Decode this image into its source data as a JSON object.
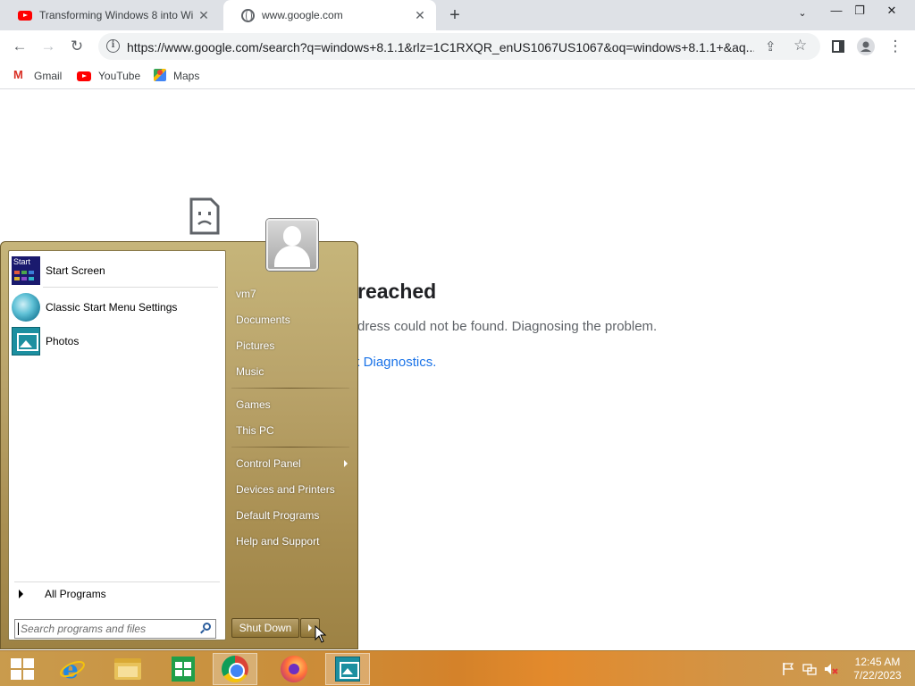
{
  "browser": {
    "tabs": [
      {
        "title": "Transforming Windows 8 into Wi",
        "favicon": "youtube-icon"
      },
      {
        "title": "www.google.com",
        "favicon": "globe-icon"
      }
    ],
    "new_tab_symbol": "+",
    "url": "https://www.google.com/search?q=windows+8.1.1&rlz=1C1RXQR_enUS1067US1067&oq=windows+8.1.1+&aq...",
    "bookmarks": [
      {
        "label": "Gmail",
        "icon": "gmail-icon"
      },
      {
        "label": "YouTube",
        "icon": "youtube-icon"
      },
      {
        "label": "Maps",
        "icon": "maps-icon"
      }
    ]
  },
  "error_page": {
    "title": "reached",
    "description": "dress could not be found. Diagnosing the problem.",
    "link_visible": "rk Diagnostics."
  },
  "start_menu": {
    "pinned": [
      {
        "label": "Start Screen",
        "icon": "start-screen-icon"
      },
      {
        "label": "Classic Start Menu Settings",
        "icon": "classic-shell-icon"
      },
      {
        "label": "Photos",
        "icon": "photos-icon"
      }
    ],
    "start_tile_text": "Start",
    "all_programs": "All Programs",
    "search_placeholder": "Search programs and files",
    "right_items": [
      {
        "label": "vm7"
      },
      {
        "label": "Documents"
      },
      {
        "label": "Pictures"
      },
      {
        "label": "Music"
      },
      {
        "label": "Games"
      },
      {
        "label": "This PC"
      },
      {
        "label": "Control Panel"
      },
      {
        "label": "Devices and Printers"
      },
      {
        "label": "Default Programs"
      },
      {
        "label": "Help and Support"
      }
    ],
    "shutdown_label": "Shut Down"
  },
  "taskbar": {
    "apps": [
      "start-button",
      "internet-explorer-icon",
      "file-explorer-icon",
      "store-icon",
      "chrome-icon",
      "firefox-icon",
      "photos-icon"
    ],
    "active_app": "chrome-icon",
    "tray_icons": [
      "flag-icon",
      "network-icon",
      "volume-muted-icon"
    ],
    "clock_time": "12:45 AM",
    "clock_date": "7/22/2023"
  },
  "colors": {
    "start_menu_gold": "#b9a36a",
    "taskbar_orange": "#d4822a",
    "link_blue": "#1a73e8"
  }
}
